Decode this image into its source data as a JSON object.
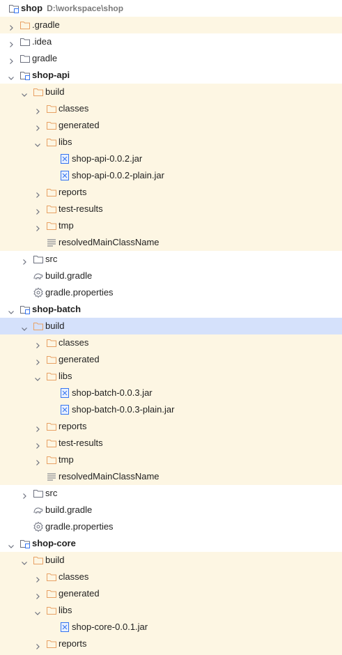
{
  "project_tree": {
    "rows": [
      {
        "name": "shop",
        "bold": true,
        "path": "D:\\workspace\\shop",
        "icon": "module-folder-icon",
        "depth": 0,
        "expand": "none",
        "bg": "none"
      },
      {
        "name": ".gradle",
        "icon": "excluded-folder-icon",
        "depth": 0,
        "expand": "collapsed",
        "bg": "excluded"
      },
      {
        "name": ".idea",
        "icon": "folder-icon",
        "depth": 0,
        "expand": "collapsed",
        "bg": "none"
      },
      {
        "name": "gradle",
        "icon": "folder-icon",
        "depth": 0,
        "expand": "collapsed",
        "bg": "none"
      },
      {
        "name": "shop-api",
        "bold": true,
        "icon": "module-folder-icon",
        "depth": 0,
        "expand": "expanded",
        "bg": "none"
      },
      {
        "name": "build",
        "icon": "excluded-folder-icon",
        "depth": 1,
        "expand": "expanded",
        "bg": "excluded"
      },
      {
        "name": "classes",
        "icon": "excluded-folder-icon",
        "depth": 2,
        "expand": "collapsed",
        "bg": "excluded"
      },
      {
        "name": "generated",
        "icon": "excluded-folder-icon",
        "depth": 2,
        "expand": "collapsed",
        "bg": "excluded"
      },
      {
        "name": "libs",
        "icon": "excluded-folder-icon",
        "depth": 2,
        "expand": "expanded",
        "bg": "excluded"
      },
      {
        "name": "shop-api-0.0.2.jar",
        "icon": "jar-file-icon",
        "depth": 3,
        "expand": "none",
        "bg": "excluded"
      },
      {
        "name": "shop-api-0.0.2-plain.jar",
        "icon": "jar-file-icon",
        "depth": 3,
        "expand": "none",
        "bg": "excluded"
      },
      {
        "name": "reports",
        "icon": "excluded-folder-icon",
        "depth": 2,
        "expand": "collapsed",
        "bg": "excluded"
      },
      {
        "name": "test-results",
        "icon": "excluded-folder-icon",
        "depth": 2,
        "expand": "collapsed",
        "bg": "excluded"
      },
      {
        "name": "tmp",
        "icon": "excluded-folder-icon",
        "depth": 2,
        "expand": "collapsed",
        "bg": "excluded"
      },
      {
        "name": "resolvedMainClassName",
        "icon": "text-file-icon",
        "depth": 2,
        "expand": "none",
        "bg": "excluded"
      },
      {
        "name": "src",
        "icon": "folder-icon",
        "depth": 1,
        "expand": "collapsed",
        "bg": "none"
      },
      {
        "name": "build.gradle",
        "icon": "gradle-elephant-icon",
        "depth": 1,
        "expand": "none",
        "bg": "none"
      },
      {
        "name": "gradle.properties",
        "icon": "gear-icon",
        "depth": 1,
        "expand": "none",
        "bg": "none"
      },
      {
        "name": "shop-batch",
        "bold": true,
        "icon": "module-folder-icon",
        "depth": 0,
        "expand": "expanded",
        "bg": "none"
      },
      {
        "name": "build",
        "icon": "excluded-folder-icon",
        "depth": 1,
        "expand": "expanded",
        "bg": "selected"
      },
      {
        "name": "classes",
        "icon": "excluded-folder-icon",
        "depth": 2,
        "expand": "collapsed",
        "bg": "excluded"
      },
      {
        "name": "generated",
        "icon": "excluded-folder-icon",
        "depth": 2,
        "expand": "collapsed",
        "bg": "excluded"
      },
      {
        "name": "libs",
        "icon": "excluded-folder-icon",
        "depth": 2,
        "expand": "expanded",
        "bg": "excluded"
      },
      {
        "name": "shop-batch-0.0.3.jar",
        "icon": "jar-file-icon",
        "depth": 3,
        "expand": "none",
        "bg": "excluded"
      },
      {
        "name": "shop-batch-0.0.3-plain.jar",
        "icon": "jar-file-icon",
        "depth": 3,
        "expand": "none",
        "bg": "excluded"
      },
      {
        "name": "reports",
        "icon": "excluded-folder-icon",
        "depth": 2,
        "expand": "collapsed",
        "bg": "excluded"
      },
      {
        "name": "test-results",
        "icon": "excluded-folder-icon",
        "depth": 2,
        "expand": "collapsed",
        "bg": "excluded"
      },
      {
        "name": "tmp",
        "icon": "excluded-folder-icon",
        "depth": 2,
        "expand": "collapsed",
        "bg": "excluded"
      },
      {
        "name": "resolvedMainClassName",
        "icon": "text-file-icon",
        "depth": 2,
        "expand": "none",
        "bg": "excluded"
      },
      {
        "name": "src",
        "icon": "folder-icon",
        "depth": 1,
        "expand": "collapsed",
        "bg": "none"
      },
      {
        "name": "build.gradle",
        "icon": "gradle-elephant-icon",
        "depth": 1,
        "expand": "none",
        "bg": "none"
      },
      {
        "name": "gradle.properties",
        "icon": "gear-icon",
        "depth": 1,
        "expand": "none",
        "bg": "none"
      },
      {
        "name": "shop-core",
        "bold": true,
        "icon": "module-folder-icon",
        "depth": 0,
        "expand": "expanded",
        "bg": "none"
      },
      {
        "name": "build",
        "icon": "excluded-folder-icon",
        "depth": 1,
        "expand": "expanded",
        "bg": "excluded"
      },
      {
        "name": "classes",
        "icon": "excluded-folder-icon",
        "depth": 2,
        "expand": "collapsed",
        "bg": "excluded"
      },
      {
        "name": "generated",
        "icon": "excluded-folder-icon",
        "depth": 2,
        "expand": "collapsed",
        "bg": "excluded"
      },
      {
        "name": "libs",
        "icon": "excluded-folder-icon",
        "depth": 2,
        "expand": "expanded",
        "bg": "excluded"
      },
      {
        "name": "shop-core-0.0.1.jar",
        "icon": "jar-file-icon",
        "depth": 3,
        "expand": "none",
        "bg": "excluded"
      },
      {
        "name": "reports",
        "icon": "excluded-folder-icon",
        "depth": 2,
        "expand": "collapsed",
        "bg": "excluded"
      },
      {
        "name": "",
        "icon": "excluded-folder-icon",
        "depth": 2,
        "expand": "collapsed",
        "bg": "excluded"
      }
    ]
  },
  "colors": {
    "excluded_bg": "#fdf6e3",
    "selected_bg": "#d5e1fb",
    "excluded_folder": "#e8a164",
    "folder": "#6c707e",
    "jar": "#3574f0",
    "path_text": "#7a7a7a"
  }
}
